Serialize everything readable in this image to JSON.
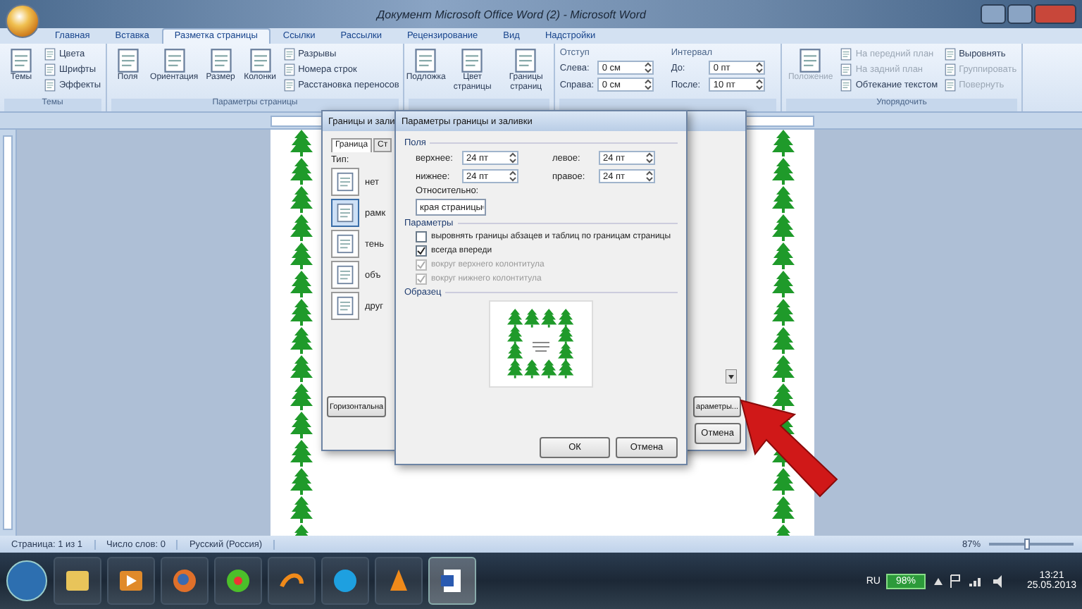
{
  "window": {
    "title": "Документ Microsoft Office Word (2) - Microsoft Word"
  },
  "ribbon_tabs": [
    {
      "label": "Главная",
      "selected": false
    },
    {
      "label": "Вставка",
      "selected": false
    },
    {
      "label": "Разметка страницы",
      "selected": true
    },
    {
      "label": "Ссылки",
      "selected": false
    },
    {
      "label": "Рассылки",
      "selected": false
    },
    {
      "label": "Рецензирование",
      "selected": false
    },
    {
      "label": "Вид",
      "selected": false
    },
    {
      "label": "Надстройки",
      "selected": false
    }
  ],
  "ribbon_groups": [
    {
      "title": "Темы",
      "items": [
        {
          "kind": "large",
          "label": "Темы"
        },
        {
          "kind": "small",
          "label": "Цвета"
        },
        {
          "kind": "small",
          "label": "Шрифты"
        },
        {
          "kind": "small",
          "label": "Эффекты"
        }
      ]
    },
    {
      "title": "Параметры страницы",
      "items": [
        {
          "kind": "large",
          "label": "Поля"
        },
        {
          "kind": "large",
          "label": "Ориентация"
        },
        {
          "kind": "large",
          "label": "Размер"
        },
        {
          "kind": "large",
          "label": "Колонки"
        },
        {
          "kind": "small",
          "label": "Разрывы"
        },
        {
          "kind": "small",
          "label": "Номера строк"
        },
        {
          "kind": "small",
          "label": "Расстановка переносов"
        }
      ]
    },
    {
      "items": [
        {
          "kind": "large",
          "label": "Подложка"
        },
        {
          "kind": "large",
          "label": "Цвет страницы"
        },
        {
          "kind": "large",
          "label": "Границы страниц"
        }
      ]
    },
    {
      "items": [
        {
          "kind": "spin-column",
          "label": "Отступ",
          "fields": [
            {
              "label": "Слева:",
              "value": "0 см"
            },
            {
              "label": "Справа:",
              "value": "0 см"
            }
          ]
        },
        {
          "kind": "spin-column",
          "label": "Интервал",
          "fields": [
            {
              "label": "До:",
              "value": "0 пт"
            },
            {
              "label": "После:",
              "value": "10 пт"
            }
          ]
        }
      ]
    },
    {
      "title": "Упорядочить",
      "items": [
        {
          "kind": "large",
          "label": "Положение",
          "disabled": true
        },
        {
          "kind": "small",
          "label": "На передний план",
          "disabled": true
        },
        {
          "kind": "small",
          "label": "На задний план",
          "disabled": true
        },
        {
          "kind": "small",
          "label": "Обтекание текстом",
          "disabled": false
        },
        {
          "kind": "small",
          "label": "Выровнять",
          "disabled": false
        },
        {
          "kind": "small",
          "label": "Группировать",
          "disabled": true
        },
        {
          "kind": "small",
          "label": "Повернуть",
          "disabled": true
        }
      ]
    }
  ],
  "borders_dialog": {
    "title": "Границы и зали",
    "tabs": [
      {
        "label": "Граница",
        "selected": true
      },
      {
        "label": "Ст",
        "selected": false
      }
    ],
    "type_label": "Тип:",
    "types": [
      {
        "label": "нет",
        "selected": false
      },
      {
        "label": "рамк",
        "selected": true
      },
      {
        "label": "тень",
        "selected": false
      },
      {
        "label": "объ",
        "selected": false
      },
      {
        "label": "друг",
        "selected": false
      }
    ],
    "buttons": [
      "Горизонтальна",
      "араметры...",
      "Отмена"
    ]
  },
  "options_dialog": {
    "title": "Параметры границы и заливки",
    "margins_label": "Поля",
    "margins": [
      {
        "label": "верхнее:",
        "value": "24 пт"
      },
      {
        "label": "левое:",
        "value": "24 пт"
      },
      {
        "label": "нижнее:",
        "value": "24 пт"
      },
      {
        "label": "правое:",
        "value": "24 пт"
      }
    ],
    "relative_label": "Относительно:",
    "relative_value": "края страницы",
    "params_label": "Параметры",
    "options": [
      {
        "label": "выровнять границы абзацев и таблиц по границам страницы",
        "checked": false,
        "disabled": false
      },
      {
        "label": "всегда впереди",
        "checked": true,
        "disabled": false
      },
      {
        "label": "вокруг верхнего колонтитула",
        "checked": true,
        "disabled": true
      },
      {
        "label": "вокруг нижнего колонтитула",
        "checked": true,
        "disabled": true
      }
    ],
    "sample_label": "Образец",
    "buttons": [
      "ОК",
      "Отмена"
    ]
  },
  "status_bar": {
    "items": [
      "Страница: 1 из 1",
      "Число слов: 0",
      "Русский (Россия)"
    ],
    "zoom": "87%",
    "zoom_slider": {
      "level": 0.45
    }
  },
  "taskbar": {
    "language": "RU",
    "battery": "98%",
    "time": "13:21",
    "date": "25.05.2013"
  }
}
